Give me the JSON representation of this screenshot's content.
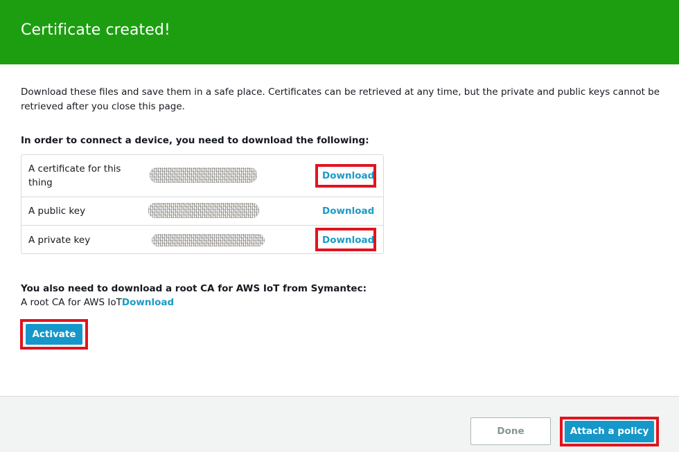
{
  "header": {
    "title": "Certificate created!"
  },
  "intro": "Download these files and save them in a safe place. Certificates can be retrieved at any time, but the private and public keys cannot be retrieved after you close this page.",
  "files_section": {
    "heading": "In order to connect a device, you need to download the following:",
    "rows": [
      {
        "label": "A certificate for this thing",
        "link": "Download"
      },
      {
        "label": "A public key",
        "link": "Download"
      },
      {
        "label": "A private key",
        "link": "Download"
      }
    ]
  },
  "root_ca": {
    "heading": "You also need to download a root CA for AWS IoT from Symantec:",
    "label": "A root CA for AWS IoT",
    "link": "Download"
  },
  "actions": {
    "activate": "Activate",
    "done": "Done",
    "attach_policy": "Attach a policy"
  },
  "colors": {
    "header_bg": "#1d9e11",
    "link": "#1a9bc6",
    "primary_button": "#1597c9",
    "highlight": "#e0141e"
  }
}
